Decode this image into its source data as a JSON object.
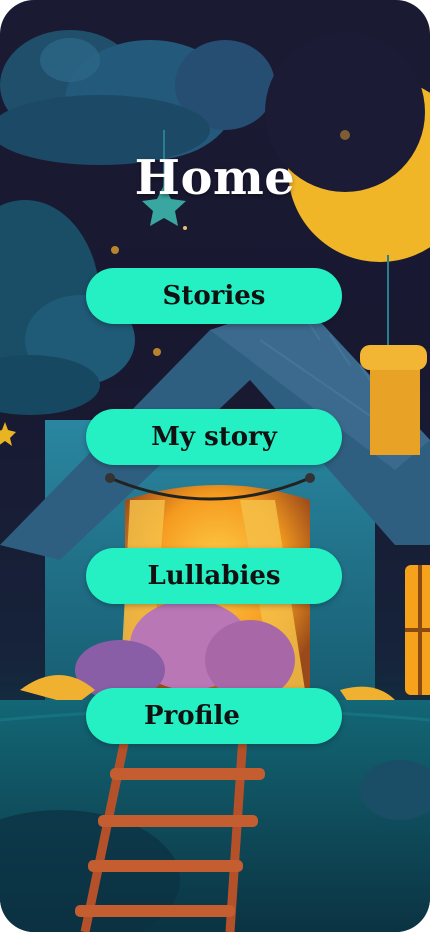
{
  "screen": {
    "title": "Home"
  },
  "menu": {
    "items": [
      {
        "label": "Stories"
      },
      {
        "label": "My story"
      },
      {
        "label": "Lullabies"
      },
      {
        "label": "Profile"
      }
    ]
  },
  "colors": {
    "button": "#24f0c4",
    "background": "#191831",
    "moon": "#e9b422",
    "house_wall": "#1f6e84",
    "roof": "#2a5b7a",
    "window_light": "#f6a21a"
  }
}
